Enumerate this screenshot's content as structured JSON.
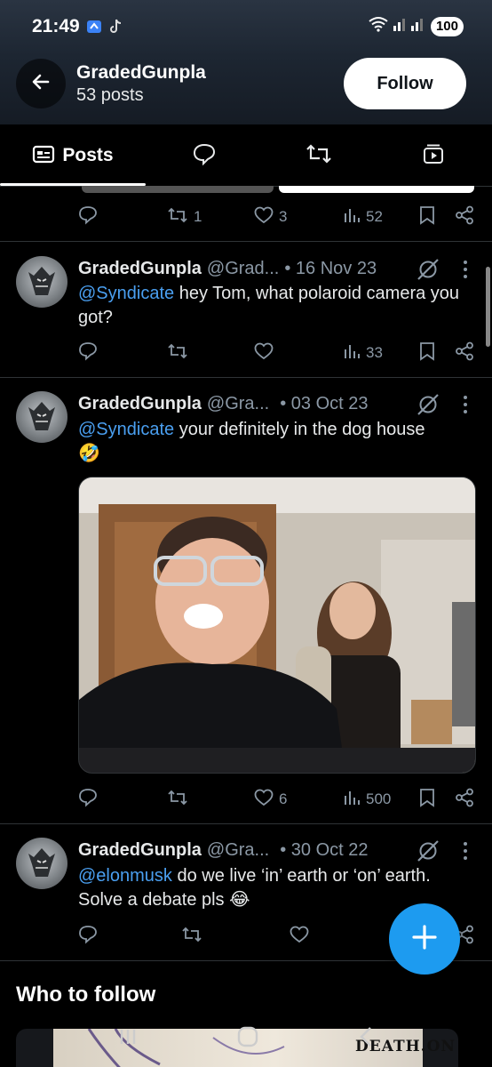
{
  "status_bar": {
    "time": "21:49",
    "battery": "100"
  },
  "header": {
    "profile_name": "GradedGunpla",
    "posts_count": "53 posts",
    "follow_label": "Follow"
  },
  "tabs": [
    {
      "label": "Posts",
      "icon": "posts-icon"
    },
    {
      "icon": "replies-icon"
    },
    {
      "icon": "repost-icon"
    },
    {
      "icon": "media-icon"
    }
  ],
  "prev_tweet": {
    "retweets": "1",
    "likes": "3",
    "views": "52"
  },
  "tweets": [
    {
      "name": "GradedGunpla",
      "handle": "@Grad...",
      "date": "• 16 Nov 23",
      "mention": "@Syndicate",
      "text": " hey Tom, what polaroid camera you got?",
      "retweets": "",
      "likes": "",
      "views": "33"
    },
    {
      "name": "GradedGunpla",
      "handle": "@Gra...",
      "date": "• 03 Oct 23",
      "mention": "@Syndicate",
      "text": " your definitely in the dog house",
      "emoji": "🤣",
      "retweets": "",
      "likes": "6",
      "views": "500"
    },
    {
      "name": "GradedGunpla",
      "handle": "@Gra...",
      "date": "• 30 Oct 22",
      "mention": "@elonmusk",
      "text": " do we live ‘in’ earth or ‘on’ earth. Solve a debate pls",
      "emoji": "😂",
      "retweets": "",
      "likes": "",
      "views": ""
    }
  ],
  "who_to_follow": {
    "title": "Who to follow",
    "banner_text": "DEATH.ON"
  },
  "colors": {
    "accent": "#1d9bf0",
    "mention": "#4a9ff0",
    "muted": "#8b98a5",
    "background": "#000000"
  }
}
